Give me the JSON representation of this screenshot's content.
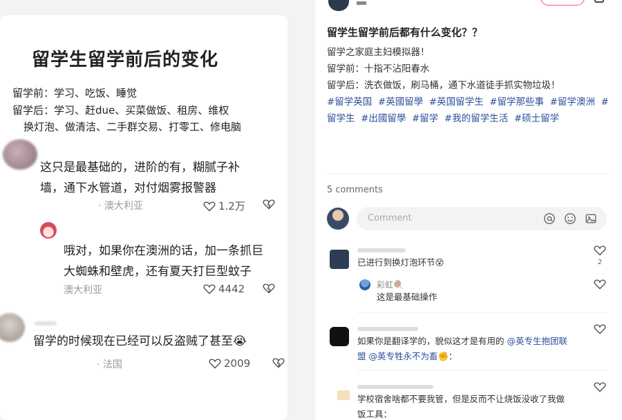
{
  "left": {
    "title": "留学生留学前后的变化",
    "before": "留学前：学习、吃饭、睡觉",
    "after_1": "留学后：学习、赶due、买菜做饭、租房、维权",
    "after_2": "换灯泡、做清洁、二手群交易、打零工、修电脑",
    "comments": [
      {
        "line1": "这只是最基础的，进阶的有，糊腻子补",
        "line2": "墙，通下水管道，对付烟雾报警器",
        "location": "· 澳大利亚",
        "likes": "1.2万"
      },
      {
        "line1": "哦对，如果你在澳洲的话，加一条抓巨",
        "line2": "大蜘蛛和壁虎，还有夏天打巨型蚊子",
        "location": "澳大利亚",
        "likes": "4442"
      },
      {
        "line1": "留学的时候现在已经可以反盗贼了甚至😭",
        "location": "· 法国",
        "likes": "2009"
      }
    ]
  },
  "post": {
    "title": "留学生留学前后都有什么变化？？",
    "line1": "留学之家庭主妇模拟器！",
    "line2": "留学前：十指不沾阳春水",
    "line3": "留学后：洗衣做饭，刷马桶，通下水道徒手抓实物垃圾！",
    "tags": [
      "#留学英国",
      "#英國留學",
      "#英国留学生",
      "#留学那些事",
      "#留学澳洲",
      "#留学生",
      "#出國留學",
      "#留学",
      "#我的留学生活",
      "#硕士留学"
    ],
    "comments_count": "5 comments",
    "comment_placeholder": "Comment"
  },
  "comments": [
    {
      "text": "已进行到换灯泡环节😵",
      "likes": "2"
    },
    {
      "name": "彩虹🍭",
      "text": "这是最基础操作"
    },
    {
      "text_a": "如果你是翻译学的，貌似这才是有用的 ",
      "mention_a": "@英专生抱团联",
      "mention_b": "盟 @英专牲永不为畜",
      "text_b": "✊："
    },
    {
      "line1": "学校宿舍啥都不要我管，但是反而不让烧饭没收了我做",
      "line2": "饭工具："
    }
  ]
}
